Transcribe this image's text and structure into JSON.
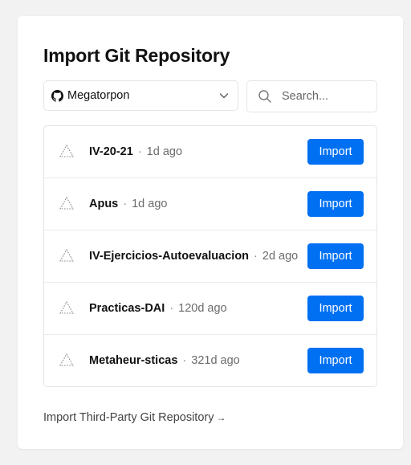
{
  "title": "Import Git Repository",
  "scope": {
    "selected": "Megatorpon",
    "provider_icon": "github-icon",
    "chevron_icon": "chevron-down-icon"
  },
  "search": {
    "placeholder": "Search...",
    "value": "",
    "icon": "search-icon"
  },
  "repositories": [
    {
      "name": "IV-20-21",
      "separator": "·",
      "updated": "1d ago",
      "action": "Import"
    },
    {
      "name": "Apus",
      "separator": "·",
      "updated": "1d ago",
      "action": "Import"
    },
    {
      "name": "IV-Ejercicios-Autoevaluacion",
      "separator": "·",
      "updated": "2d ago",
      "action": "Import"
    },
    {
      "name": "Practicas-DAI",
      "separator": "·",
      "updated": "120d ago",
      "action": "Import"
    },
    {
      "name": "Metaheur-sticas",
      "separator": "·",
      "updated": "321d ago",
      "action": "Import"
    }
  ],
  "third_party": {
    "label": "Import Third-Party Git Repository",
    "arrow": "→"
  },
  "colors": {
    "accent": "#0070f3",
    "border": "#e5e5e5",
    "muted_text": "#6b6b6b",
    "page_background": "#f2f2f2"
  }
}
